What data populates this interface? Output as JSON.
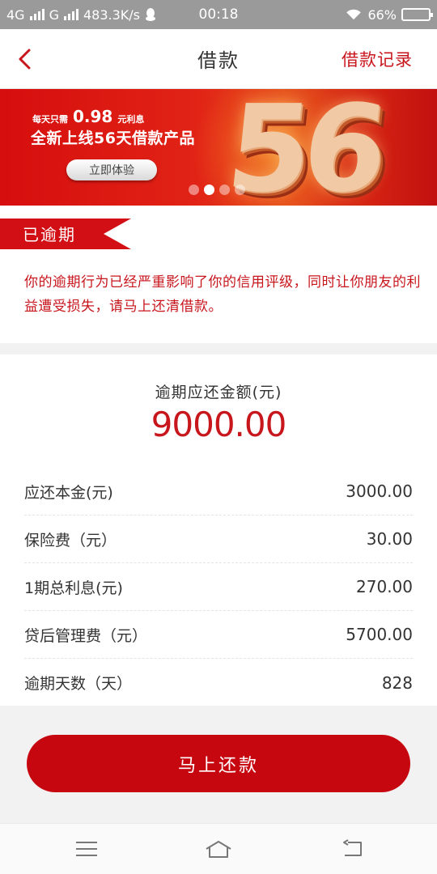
{
  "status_bar": {
    "network1": "4G",
    "network2": "G",
    "speed": "483.3K/s",
    "time": "00:18",
    "battery": "66%",
    "battery_level": 0.66
  },
  "header": {
    "title": "借款",
    "right_link": "借款记录"
  },
  "banner": {
    "line1_prefix": "每天只需",
    "line1_amount": "0.98",
    "line1_suffix": "元利息",
    "line2": "全新上线56天借款产品",
    "button": "立即体验",
    "big_number": "56",
    "dots": [
      false,
      true,
      false,
      false
    ]
  },
  "notice": {
    "label": "已逾期",
    "text": "你的逾期行为已经严重影响了你的信用评级，同时让你朋友的利益遭受损失，请马上还清借款。"
  },
  "amount": {
    "label": "逾期应还金额(元)",
    "value": "9000.00"
  },
  "rows": [
    {
      "label": "应还本金(元)",
      "value": "3000.00"
    },
    {
      "label": "保险费（元）",
      "value": "30.00"
    },
    {
      "label": "1期总利息(元)",
      "value": "270.00"
    },
    {
      "label": "贷后管理费（元）",
      "value": "5700.00"
    },
    {
      "label": "逾期天数（天）",
      "value": "828"
    }
  ],
  "pay_button": "马上还款",
  "colors": {
    "accent": "#c8161d",
    "button": "#c70710",
    "status_bar": "#9a9a9a"
  }
}
